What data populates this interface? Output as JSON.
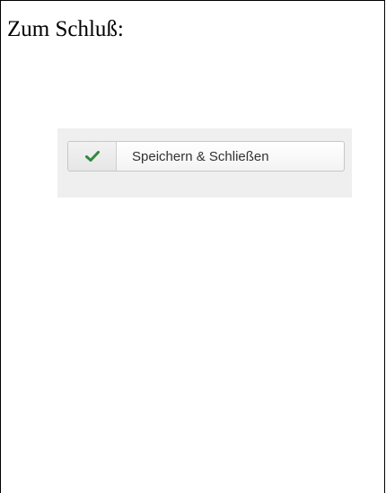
{
  "heading": "Zum Schluß:",
  "save_close_button": {
    "label": "Speichern & Schließen",
    "icon": "checkmark-icon",
    "icon_color": "#2f8a3b"
  }
}
